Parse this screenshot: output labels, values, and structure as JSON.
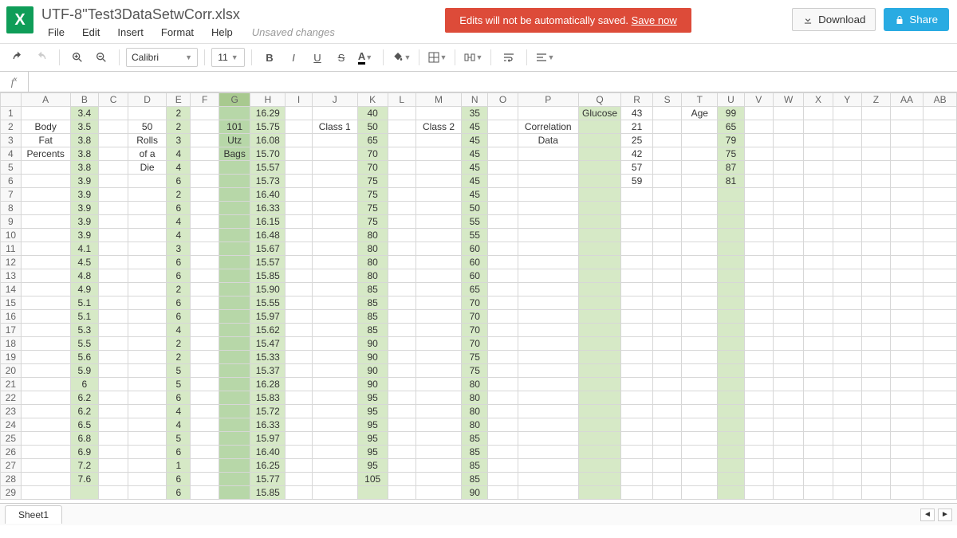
{
  "doc": {
    "title": "UTF-8''Test3DataSetwCorr.xlsx",
    "unsaved": "Unsaved changes"
  },
  "menu": {
    "file": "File",
    "edit": "Edit",
    "insert": "Insert",
    "format": "Format",
    "help": "Help"
  },
  "banner": {
    "text": "Edits will not be automatically saved.  ",
    "link": "Save now"
  },
  "buttons": {
    "download": "Download",
    "share": "Share"
  },
  "toolbar": {
    "font": "Calibri",
    "size": "11"
  },
  "fx": {
    "value": ""
  },
  "columns": [
    "A",
    "B",
    "C",
    "D",
    "E",
    "F",
    "G",
    "H",
    "I",
    "J",
    "K",
    "L",
    "M",
    "N",
    "O",
    "P",
    "Q",
    "R",
    "S",
    "T",
    "U",
    "V",
    "W",
    "X",
    "Y",
    "Z",
    "AA",
    "AB"
  ],
  "highlightCols": [
    "B",
    "E",
    "H",
    "K",
    "N",
    "Q",
    "U"
  ],
  "selectedCol": "G",
  "rows": 29,
  "cells": {
    "A2": "Body",
    "A3": "Fat",
    "A4": "Percents",
    "B1": "3.4",
    "B2": "3.5",
    "B3": "3.8",
    "B4": "3.8",
    "B5": "3.8",
    "B6": "3.9",
    "B7": "3.9",
    "B8": "3.9",
    "B9": "3.9",
    "B10": "3.9",
    "B11": "4.1",
    "B12": "4.5",
    "B13": "4.8",
    "B14": "4.9",
    "B15": "5.1",
    "B16": "5.1",
    "B17": "5.3",
    "B18": "5.5",
    "B19": "5.6",
    "B20": "5.9",
    "B21": "6",
    "B22": "6.2",
    "B23": "6.2",
    "B24": "6.5",
    "B25": "6.8",
    "B26": "6.9",
    "B27": "7.2",
    "B28": "7.6",
    "D2": "50",
    "D3": "Rolls",
    "D4": "of a",
    "D5": "Die",
    "E1": "2",
    "E2": "2",
    "E3": "3",
    "E4": "4",
    "E5": "4",
    "E6": "6",
    "E7": "2",
    "E8": "6",
    "E9": "4",
    "E10": "4",
    "E11": "3",
    "E12": "6",
    "E13": "6",
    "E14": "2",
    "E15": "6",
    "E16": "6",
    "E17": "4",
    "E18": "2",
    "E19": "2",
    "E20": "5",
    "E21": "5",
    "E22": "6",
    "E23": "4",
    "E24": "4",
    "E25": "5",
    "E26": "6",
    "E27": "1",
    "E28": "6",
    "E29": "6",
    "G2": "101",
    "G3": "Utz",
    "G4": "Bags",
    "H1": "16.29",
    "H2": "15.75",
    "H3": "16.08",
    "H4": "15.70",
    "H5": "15.57",
    "H6": "15.73",
    "H7": "16.40",
    "H8": "16.33",
    "H9": "16.15",
    "H10": "16.48",
    "H11": "15.67",
    "H12": "15.57",
    "H13": "15.85",
    "H14": "15.90",
    "H15": "15.55",
    "H16": "15.97",
    "H17": "15.62",
    "H18": "15.47",
    "H19": "15.33",
    "H20": "15.37",
    "H21": "16.28",
    "H22": "15.83",
    "H23": "15.72",
    "H24": "16.33",
    "H25": "15.97",
    "H26": "16.40",
    "H27": "16.25",
    "H28": "15.77",
    "H29": "15.85",
    "J2": "Class 1",
    "K1": "40",
    "K2": "50",
    "K3": "65",
    "K4": "70",
    "K5": "70",
    "K6": "75",
    "K7": "75",
    "K8": "75",
    "K9": "75",
    "K10": "80",
    "K11": "80",
    "K12": "80",
    "K13": "80",
    "K14": "85",
    "K15": "85",
    "K16": "85",
    "K17": "85",
    "K18": "90",
    "K19": "90",
    "K20": "90",
    "K21": "90",
    "K22": "95",
    "K23": "95",
    "K24": "95",
    "K25": "95",
    "K26": "95",
    "K27": "95",
    "K28": "105",
    "M2": "Class 2",
    "N1": "35",
    "N2": "45",
    "N3": "45",
    "N4": "45",
    "N5": "45",
    "N6": "45",
    "N7": "45",
    "N8": "50",
    "N9": "55",
    "N10": "55",
    "N11": "60",
    "N12": "60",
    "N13": "60",
    "N14": "65",
    "N15": "70",
    "N16": "70",
    "N17": "70",
    "N18": "70",
    "N19": "75",
    "N20": "75",
    "N21": "80",
    "N22": "80",
    "N23": "80",
    "N24": "80",
    "N25": "85",
    "N26": "85",
    "N27": "85",
    "N28": "85",
    "N29": "90",
    "P2": "Correlation",
    "P3": "Data",
    "Q1": "Glucose",
    "R1": "43",
    "R2": "21",
    "R3": "25",
    "R4": "42",
    "R5": "57",
    "R6": "59",
    "T1": "Age",
    "U1": "99",
    "U2": "65",
    "U3": "79",
    "U4": "75",
    "U5": "87",
    "U6": "81"
  },
  "tab": {
    "name": "Sheet1"
  }
}
